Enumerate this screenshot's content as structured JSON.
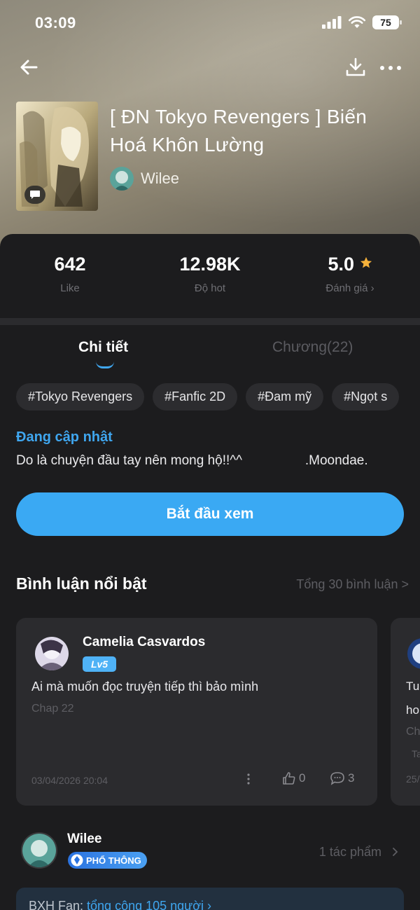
{
  "status_bar": {
    "time": "03:09",
    "battery": "75"
  },
  "book": {
    "title": "[ ĐN Tokyo Revengers ] Biến Hoá Khôn Lường",
    "author": "Wilee"
  },
  "stats": [
    {
      "value": "642",
      "label": "Like"
    },
    {
      "value": "12.98K",
      "label": "Độ hot"
    },
    {
      "value": "5.0",
      "label": "Đánh giá ›"
    }
  ],
  "tabs": [
    {
      "label": "Chi tiết",
      "active": true
    },
    {
      "label": "Chương(22)",
      "active": false
    }
  ],
  "tags": [
    "#Tokyo Revengers",
    "#Fanfic 2D",
    "#Đam mỹ",
    "#Ngọt s"
  ],
  "update_status": "Đang cập nhật",
  "description": "Do là chuyện đầu tay nên mong hộ!!^^                 .Moondae.",
  "start_button": "Bắt đầu xem",
  "comments": {
    "title": "Bình luận nổi bật",
    "total": "Tổng 30 bình luận >",
    "items": [
      {
        "user": "Camelia Casvardos",
        "level": "Lv5",
        "text": "Ai mà muốn đọc truyện tiếp thì bảo mình",
        "chapter": "Chap 22",
        "date": "03/04/2026 20:04",
        "likes": "0",
        "replies": "3"
      }
    ],
    "next_preview": {
      "line1": "Tu",
      "line2": "ho",
      "line3": "Ch",
      "line4": "Ta",
      "date": "25/"
    }
  },
  "author_section": {
    "name": "Wilee",
    "badge": "PHỔ THÔNG",
    "works": "1 tác phẩm"
  },
  "fan_bar": {
    "label": "BXH Fan: ",
    "link": "tổng cộng 105 người ›"
  },
  "colors": {
    "accent": "#3aa9f3",
    "panel": "#1c1c1e",
    "card": "#2b2b2e",
    "star": "#f6b23b"
  }
}
